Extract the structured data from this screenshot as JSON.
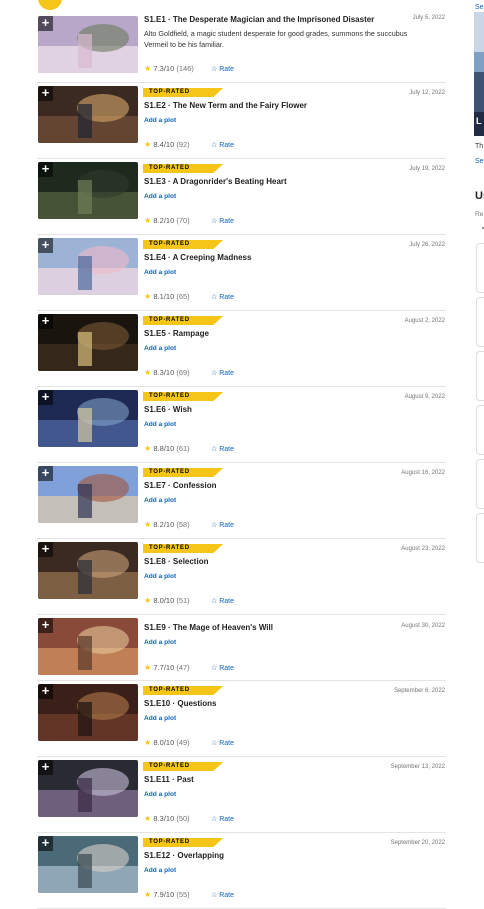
{
  "episodes": [
    {
      "code": "S1.E1",
      "title": "The Desperate Magician and the Imprisoned Disaster",
      "date": "July 5, 2022",
      "top_rated": false,
      "plot": "Alto Goldfield, a magic student desperate for good grades, summons the succubus Vermeil to be his familiar.",
      "rating": "7.3",
      "votes": "(146)"
    },
    {
      "code": "S1.E2",
      "title": "The New Term and the Fairy Flower",
      "date": "July 12, 2022",
      "top_rated": true,
      "plot": null,
      "rating": "8.4",
      "votes": "(92)"
    },
    {
      "code": "S1.E3",
      "title": "A Dragonrider's Beating Heart",
      "date": "July 19, 2022",
      "top_rated": true,
      "plot": null,
      "rating": "8.2",
      "votes": "(70)"
    },
    {
      "code": "S1.E4",
      "title": "A Creeping Madness",
      "date": "July 26, 2022",
      "top_rated": true,
      "plot": null,
      "rating": "8.1",
      "votes": "(65)"
    },
    {
      "code": "S1.E5",
      "title": "Rampage",
      "date": "August 2, 2022",
      "top_rated": true,
      "plot": null,
      "rating": "8.3",
      "votes": "(69)"
    },
    {
      "code": "S1.E6",
      "title": "Wish",
      "date": "August 9, 2022",
      "top_rated": true,
      "plot": null,
      "rating": "8.8",
      "votes": "(61)"
    },
    {
      "code": "S1.E7",
      "title": "Confession",
      "date": "August 16, 2022",
      "top_rated": true,
      "plot": null,
      "rating": "8.2",
      "votes": "(58)"
    },
    {
      "code": "S1.E8",
      "title": "Selection",
      "date": "August 23, 2022",
      "top_rated": true,
      "plot": null,
      "rating": "8.0",
      "votes": "(51)"
    },
    {
      "code": "S1.E9",
      "title": "The Mage of Heaven's Will",
      "date": "August 30, 2022",
      "top_rated": false,
      "plot": null,
      "rating": "7.7",
      "votes": "(47)"
    },
    {
      "code": "S1.E10",
      "title": "Questions",
      "date": "September 6, 2022",
      "top_rated": true,
      "plot": null,
      "rating": "8.0",
      "votes": "(49)"
    },
    {
      "code": "S1.E11",
      "title": "Past",
      "date": "September 13, 2022",
      "top_rated": true,
      "plot": null,
      "rating": "8.3",
      "votes": "(50)"
    },
    {
      "code": "S1.E12",
      "title": "Overlapping",
      "date": "September 20, 2022",
      "top_rated": true,
      "plot": null,
      "rating": "7.9",
      "votes": "(55)"
    }
  ],
  "labels": {
    "top_rated": "TOP-RATED",
    "add_plot": "Add a plot",
    "rate": "☆ Rate",
    "out_of": "/10",
    "separator": " · ",
    "plus": "+"
  },
  "sidebar": {
    "link_top": "Se",
    "caption": "Th",
    "link_mid": "Se",
    "heading": "Us",
    "sub": "Re",
    "image_overlay": "L"
  },
  "colors": {
    "accent": "#f5c518",
    "link": "#0e63be"
  }
}
